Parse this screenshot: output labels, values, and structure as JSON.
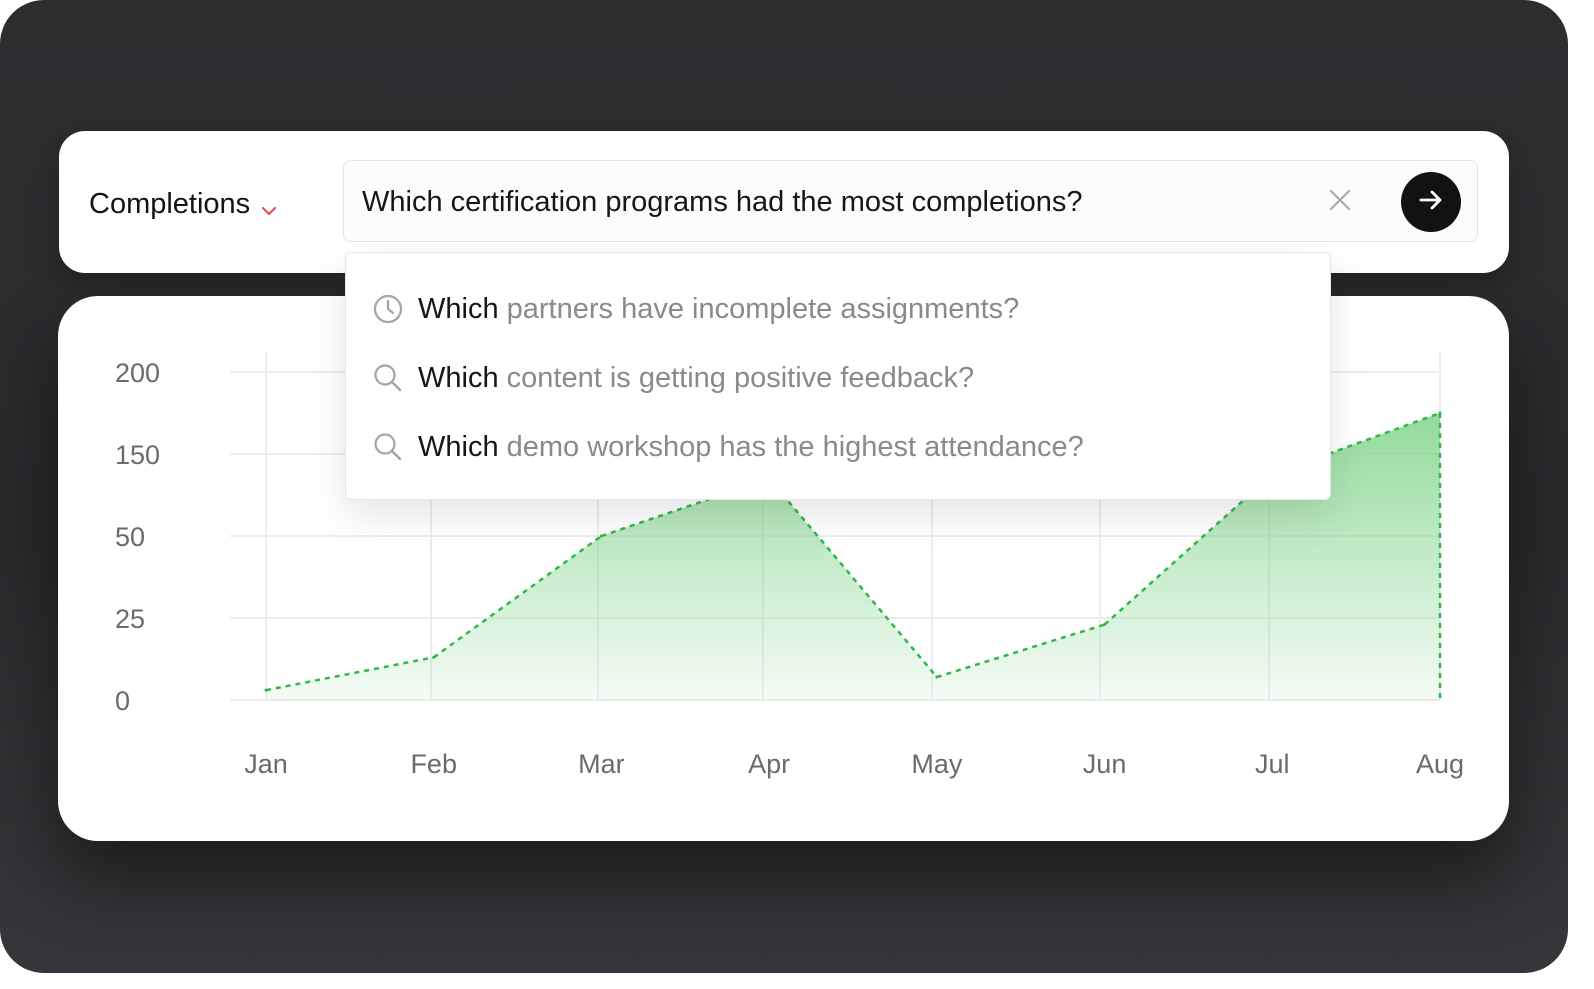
{
  "query_bar": {
    "metric_label": "Completions",
    "search_value": "Which certification programs had the most completions?",
    "icons": {
      "metric_dropdown": "chevron-down-icon",
      "clear": "close-icon",
      "submit": "arrow-right-icon"
    },
    "colors": {
      "chevron": "#e0494a",
      "submit_bg": "#121212"
    }
  },
  "suggestions": [
    {
      "icon": "clock-icon",
      "lead": "Which",
      "rest": "partners have incomplete assignments?"
    },
    {
      "icon": "search-icon",
      "lead": "Which",
      "rest": "content is getting positive feedback?"
    },
    {
      "icon": "search-icon",
      "lead": "Which",
      "rest": "demo workshop has the highest attendance?"
    }
  ],
  "chart_data": {
    "type": "area",
    "categories": [
      "Jan",
      "Feb",
      "Mar",
      "Apr",
      "May",
      "Jun",
      "Jul",
      "Aug"
    ],
    "y_tick_labels": [
      "0",
      "25",
      "50",
      "150",
      "200"
    ],
    "values": [
      3,
      13,
      50,
      120,
      7,
      23,
      125,
      175
    ],
    "title": "",
    "xlabel": "",
    "ylabel": "",
    "grid": true,
    "line_style": "dashed",
    "colors": {
      "line": "#2fb84a",
      "fill": "#7fd48a"
    }
  }
}
